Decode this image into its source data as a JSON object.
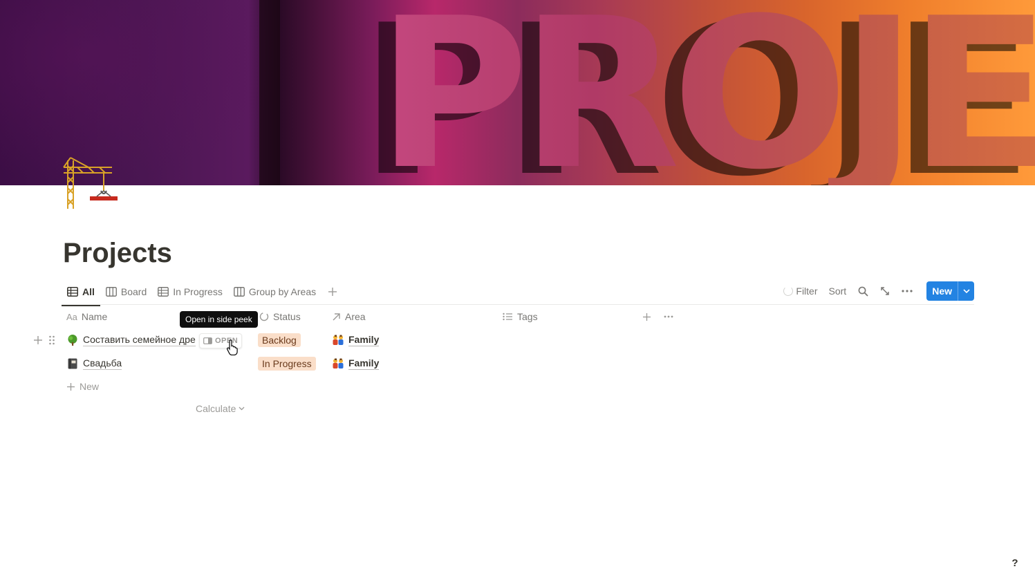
{
  "cover": {
    "word": "PROJECTS"
  },
  "page": {
    "title": "Projects",
    "icon": "construction-crane-icon"
  },
  "views": {
    "tabs": [
      {
        "label": "All",
        "icon": "table-icon",
        "active": true
      },
      {
        "label": "Board",
        "icon": "board-icon",
        "active": false
      },
      {
        "label": "In Progress",
        "icon": "table-icon",
        "active": false
      },
      {
        "label": "Group by Areas",
        "icon": "board-icon",
        "active": false
      }
    ]
  },
  "toolbar": {
    "filter_label": "Filter",
    "sort_label": "Sort",
    "new_label": "New"
  },
  "table": {
    "columns": {
      "name": {
        "label": "Name",
        "icon": "Aa"
      },
      "status": {
        "label": "Status"
      },
      "area": {
        "label": "Area"
      },
      "tags": {
        "label": "Tags"
      }
    },
    "rows": [
      {
        "name": "Составить семейное дре",
        "icon": "tree-icon",
        "status": "Backlog",
        "area": "Family",
        "area_icon": "family-icon"
      },
      {
        "name": "Свадьба",
        "icon": "notebook-icon",
        "status": "In Progress",
        "area": "Family",
        "area_icon": "family-icon"
      }
    ],
    "add_row_label": "New",
    "calculate_label": "Calculate",
    "open_button_label": "OPEN"
  },
  "tooltip": {
    "text": "Open in side peek"
  },
  "help": {
    "label": "?"
  },
  "colors": {
    "accent": "#2383e2",
    "status_backlog_bg": "#fadec9",
    "status_progress_bg": "#fadec9",
    "text": "#37352f",
    "muted": "#787774"
  }
}
